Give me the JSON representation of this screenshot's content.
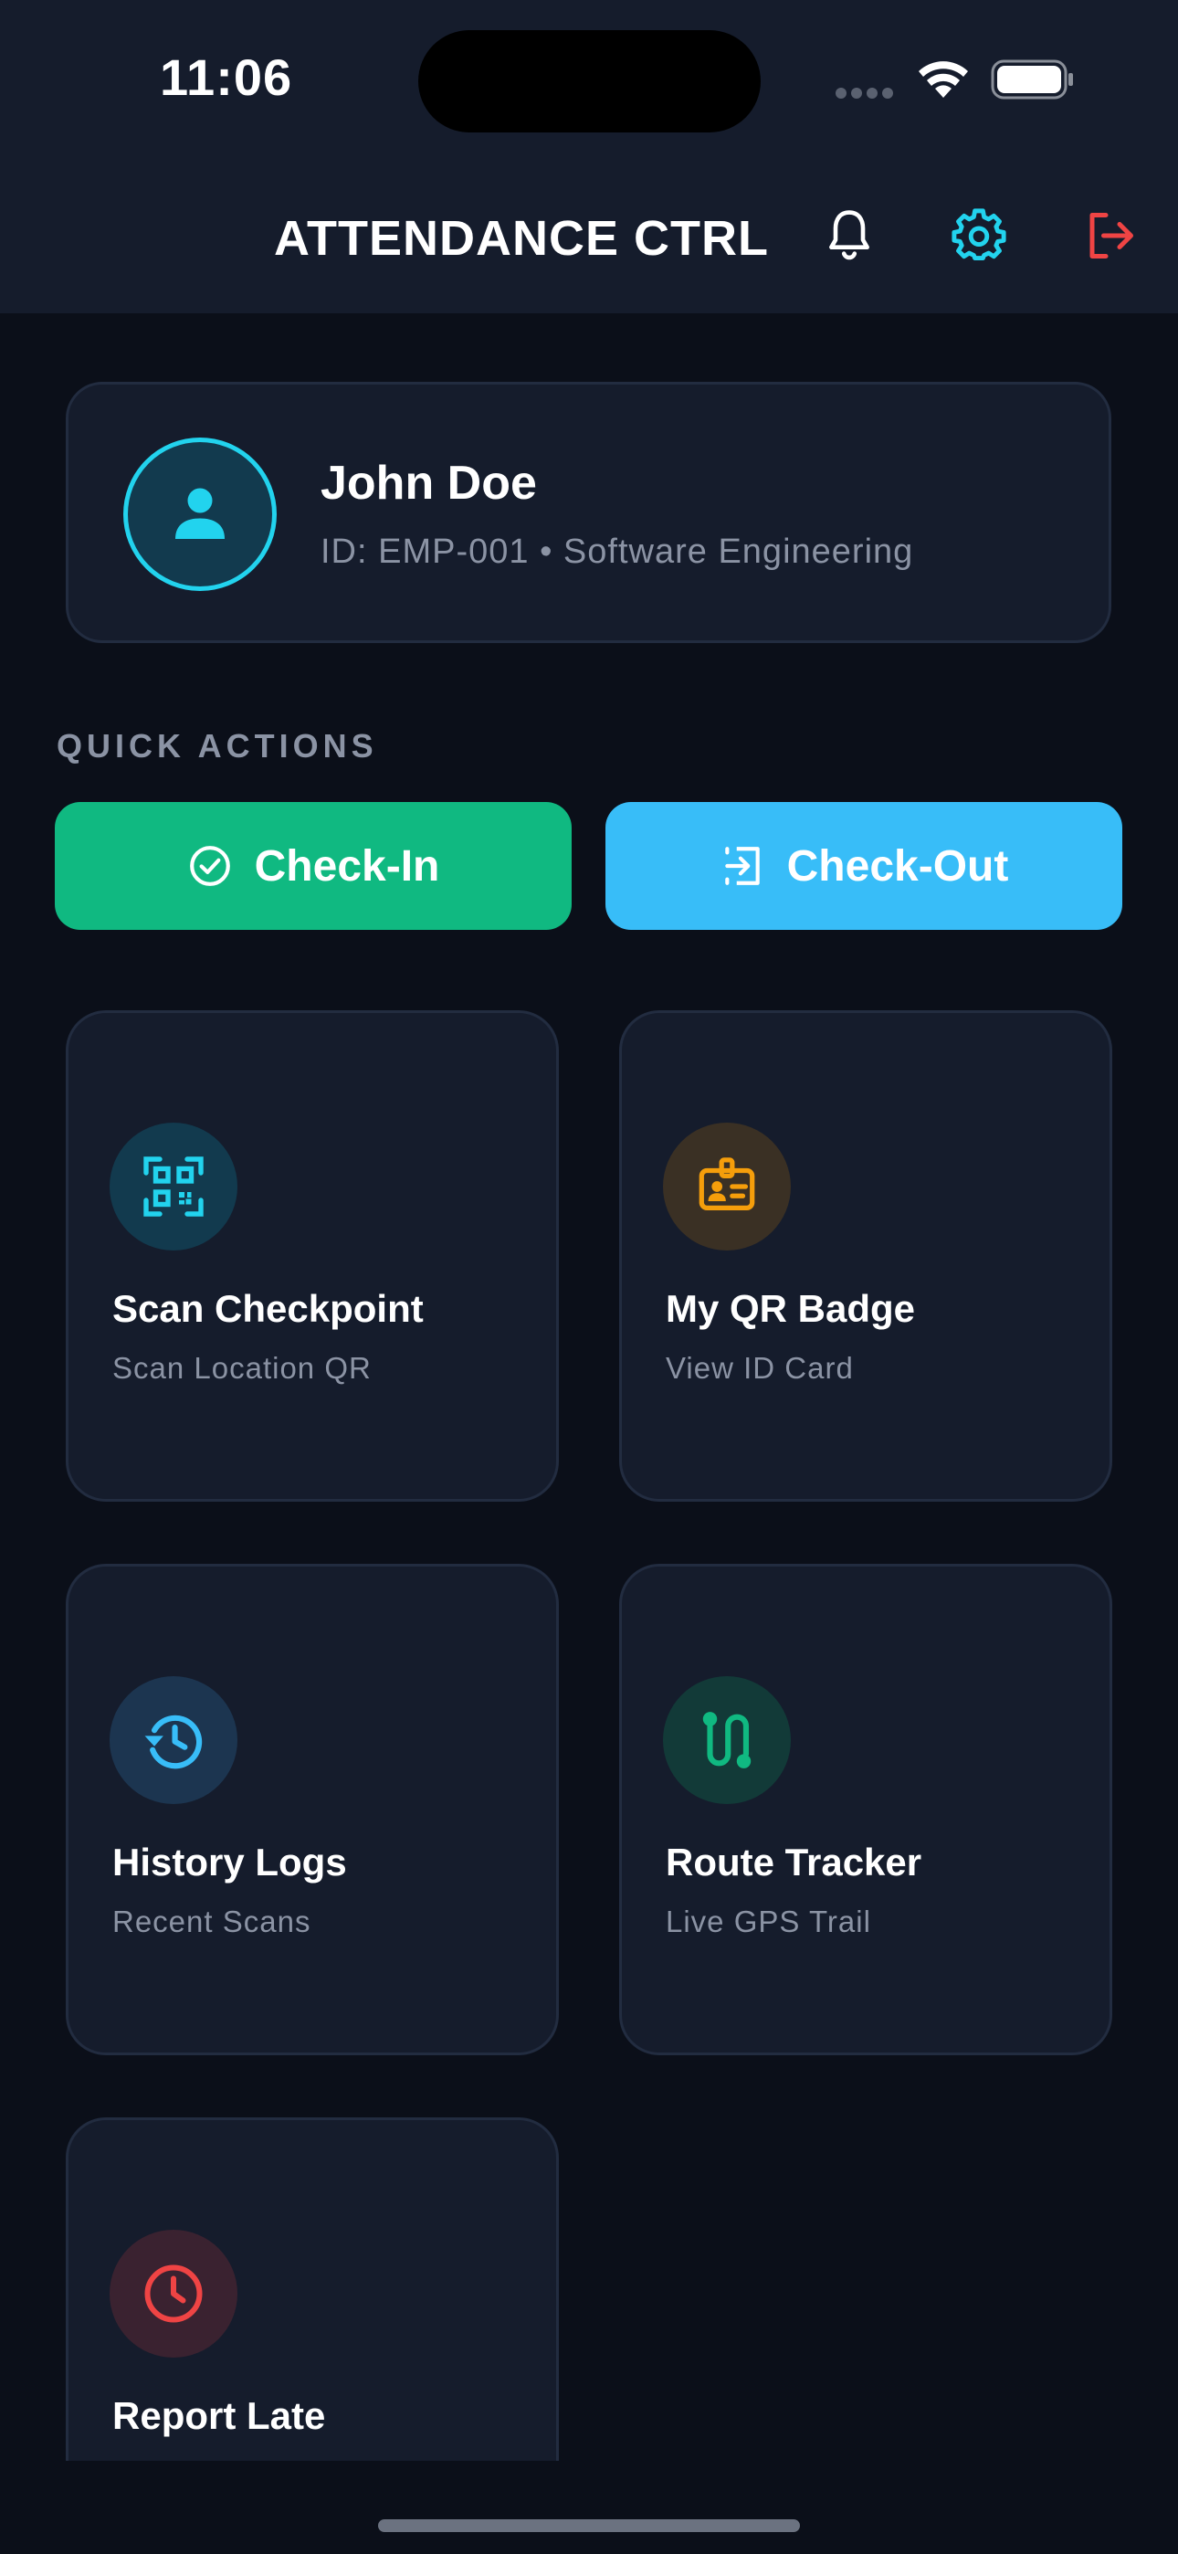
{
  "status_bar": {
    "time": "11:06"
  },
  "app_bar": {
    "title": "ATTENDANCE CTRL",
    "icons": [
      "bell-icon",
      "gear-icon",
      "logout-icon"
    ]
  },
  "profile": {
    "name": "John Doe",
    "subtitle": "ID: EMP-001 • Software Engineering"
  },
  "quick_actions": {
    "label": "QUICK ACTIONS",
    "check_in": "Check-In",
    "check_out": "Check-Out"
  },
  "tiles": [
    {
      "title": "Scan Checkpoint",
      "subtitle": "Scan Location QR",
      "icon": "qr-scan-icon"
    },
    {
      "title": "My QR Badge",
      "subtitle": "View ID Card",
      "icon": "id-badge-icon"
    },
    {
      "title": "History Logs",
      "subtitle": "Recent Scans",
      "icon": "history-icon"
    },
    {
      "title": "Route Tracker",
      "subtitle": "Live GPS Trail",
      "icon": "route-icon"
    },
    {
      "title": "Report Late",
      "subtitle": "",
      "icon": "clock-icon"
    }
  ],
  "colors": {
    "background": "#0b0f19",
    "surface": "#151c2c",
    "accent_cyan": "#22d3ee",
    "check_in_green": "#10b981",
    "check_out_blue": "#38bdf8",
    "badge_orange": "#f59e0b",
    "danger_red": "#ef4444",
    "muted_text": "#8b93a4"
  }
}
